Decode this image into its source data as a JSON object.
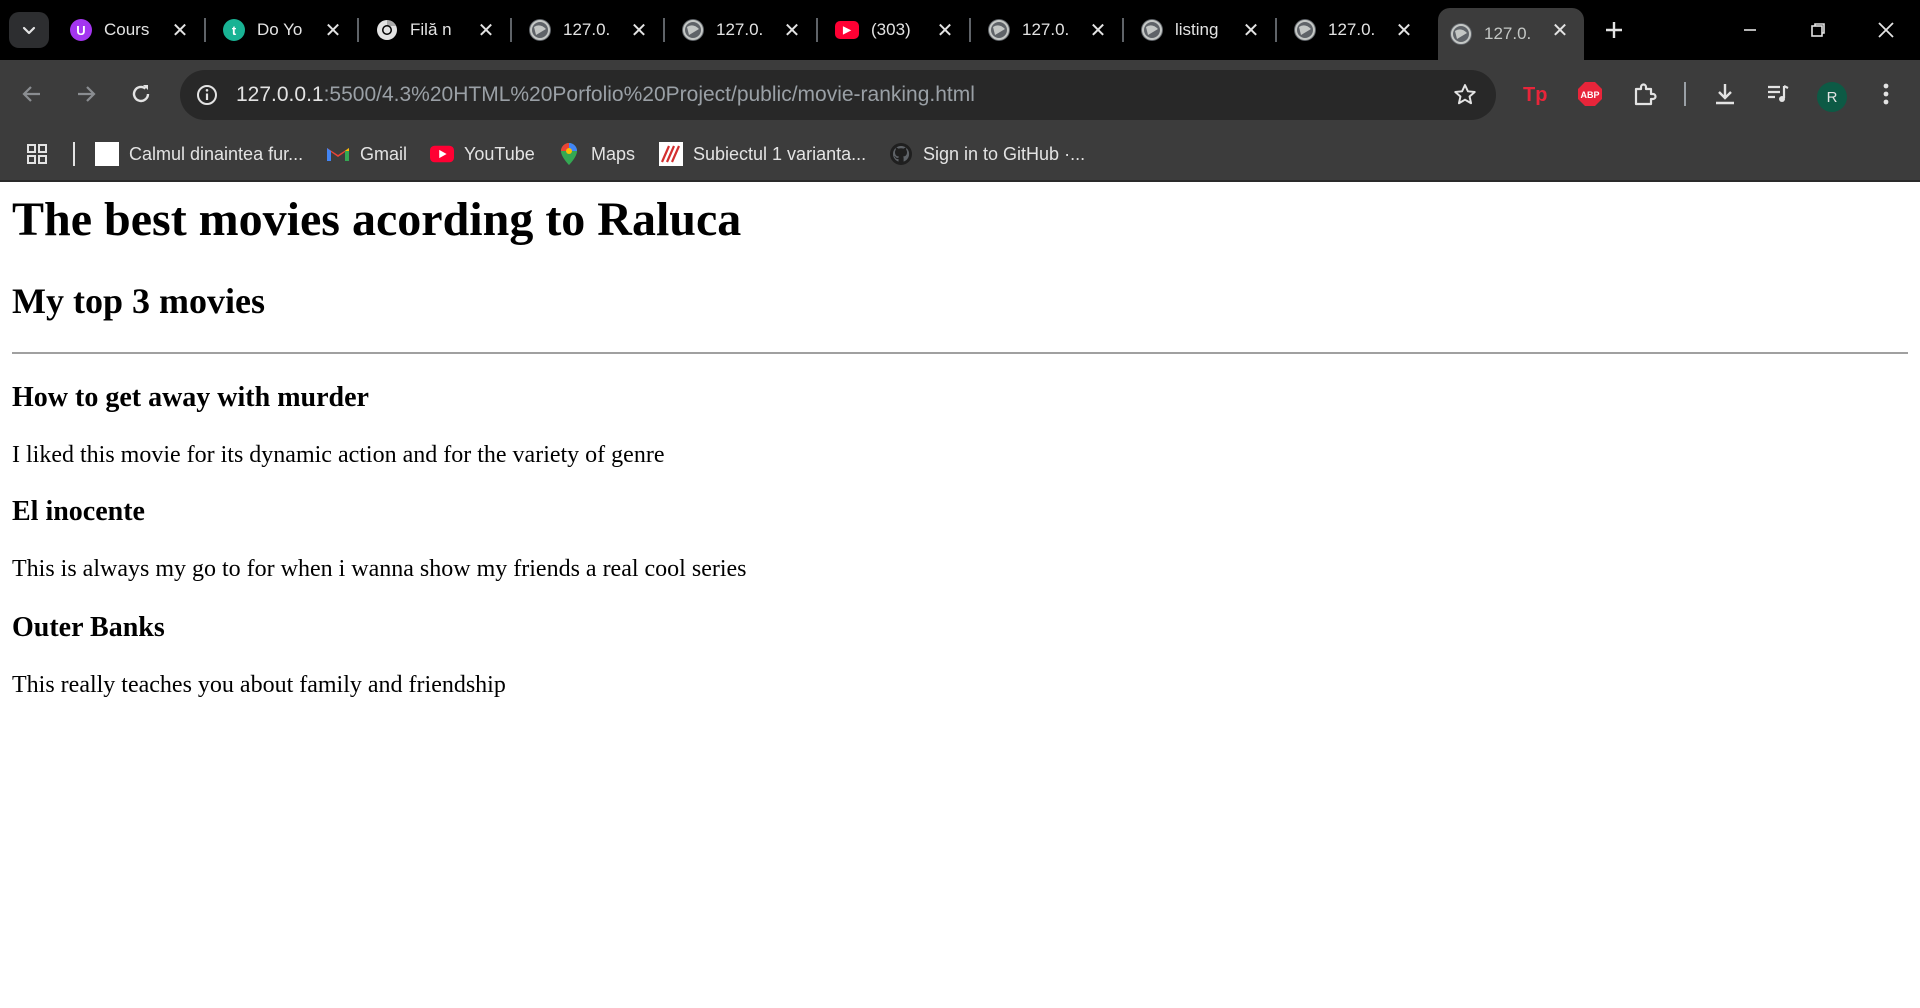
{
  "tabs": [
    {
      "title": "Cours",
      "icon": "udemy-icon",
      "color": "#a435f0",
      "glyph": "U"
    },
    {
      "title": "Do Yo",
      "icon": "teal-t-icon",
      "color": "#19b394",
      "glyph": "t"
    },
    {
      "title": "Filă n",
      "icon": "chrome-icon",
      "color": "#ffffff",
      "glyph": ""
    },
    {
      "title": "127.0.",
      "icon": "globe-icon",
      "color": "#5f6368",
      "glyph": ""
    },
    {
      "title": "127.0.",
      "icon": "globe-icon",
      "color": "#5f6368",
      "glyph": ""
    },
    {
      "title": "(303)",
      "icon": "youtube-icon",
      "color": "#ff0033",
      "glyph": "▶"
    },
    {
      "title": "127.0.",
      "icon": "globe-icon",
      "color": "#5f6368",
      "glyph": ""
    },
    {
      "title": "listing",
      "icon": "globe-icon",
      "color": "#5f6368",
      "glyph": ""
    },
    {
      "title": "127.0.",
      "icon": "globe-icon",
      "color": "#5f6368",
      "glyph": ""
    },
    {
      "title": "127.0.",
      "icon": "globe-icon",
      "color": "#5f6368",
      "glyph": "",
      "active": true
    }
  ],
  "address": {
    "host": "127.0.0.1",
    "path": ":5500/4.3%20HTML%20Porfolio%20Project/public/movie-ranking.html"
  },
  "profile": {
    "initial": "R"
  },
  "bookmarks": [
    {
      "label": "Calmul dinaintea fur...",
      "icon": "page-icon"
    },
    {
      "label": "Gmail",
      "icon": "gmail-icon"
    },
    {
      "label": "YouTube",
      "icon": "youtube-icon"
    },
    {
      "label": "Maps",
      "icon": "maps-icon"
    },
    {
      "label": "Subiectul 1 varianta...",
      "icon": "bookmark-site-icon"
    },
    {
      "label": "Sign in to GitHub ·...",
      "icon": "github-icon"
    }
  ],
  "page": {
    "title": "The best movies acording to Raluca",
    "subtitle": "My top 3 movies",
    "movies": [
      {
        "name": "How to get away with murder",
        "description": "I liked this movie for its dynamic action and for the variety of genre"
      },
      {
        "name": "El inocente",
        "description": "This is always my go to for when i wanna show my friends a real cool series"
      },
      {
        "name": "Outer Banks",
        "description": "This really teaches you about family and friendship"
      }
    ]
  },
  "colors": {
    "accent_youtube": "#ff0033",
    "adblock": "#e8253a",
    "tp": "#e8253a"
  }
}
